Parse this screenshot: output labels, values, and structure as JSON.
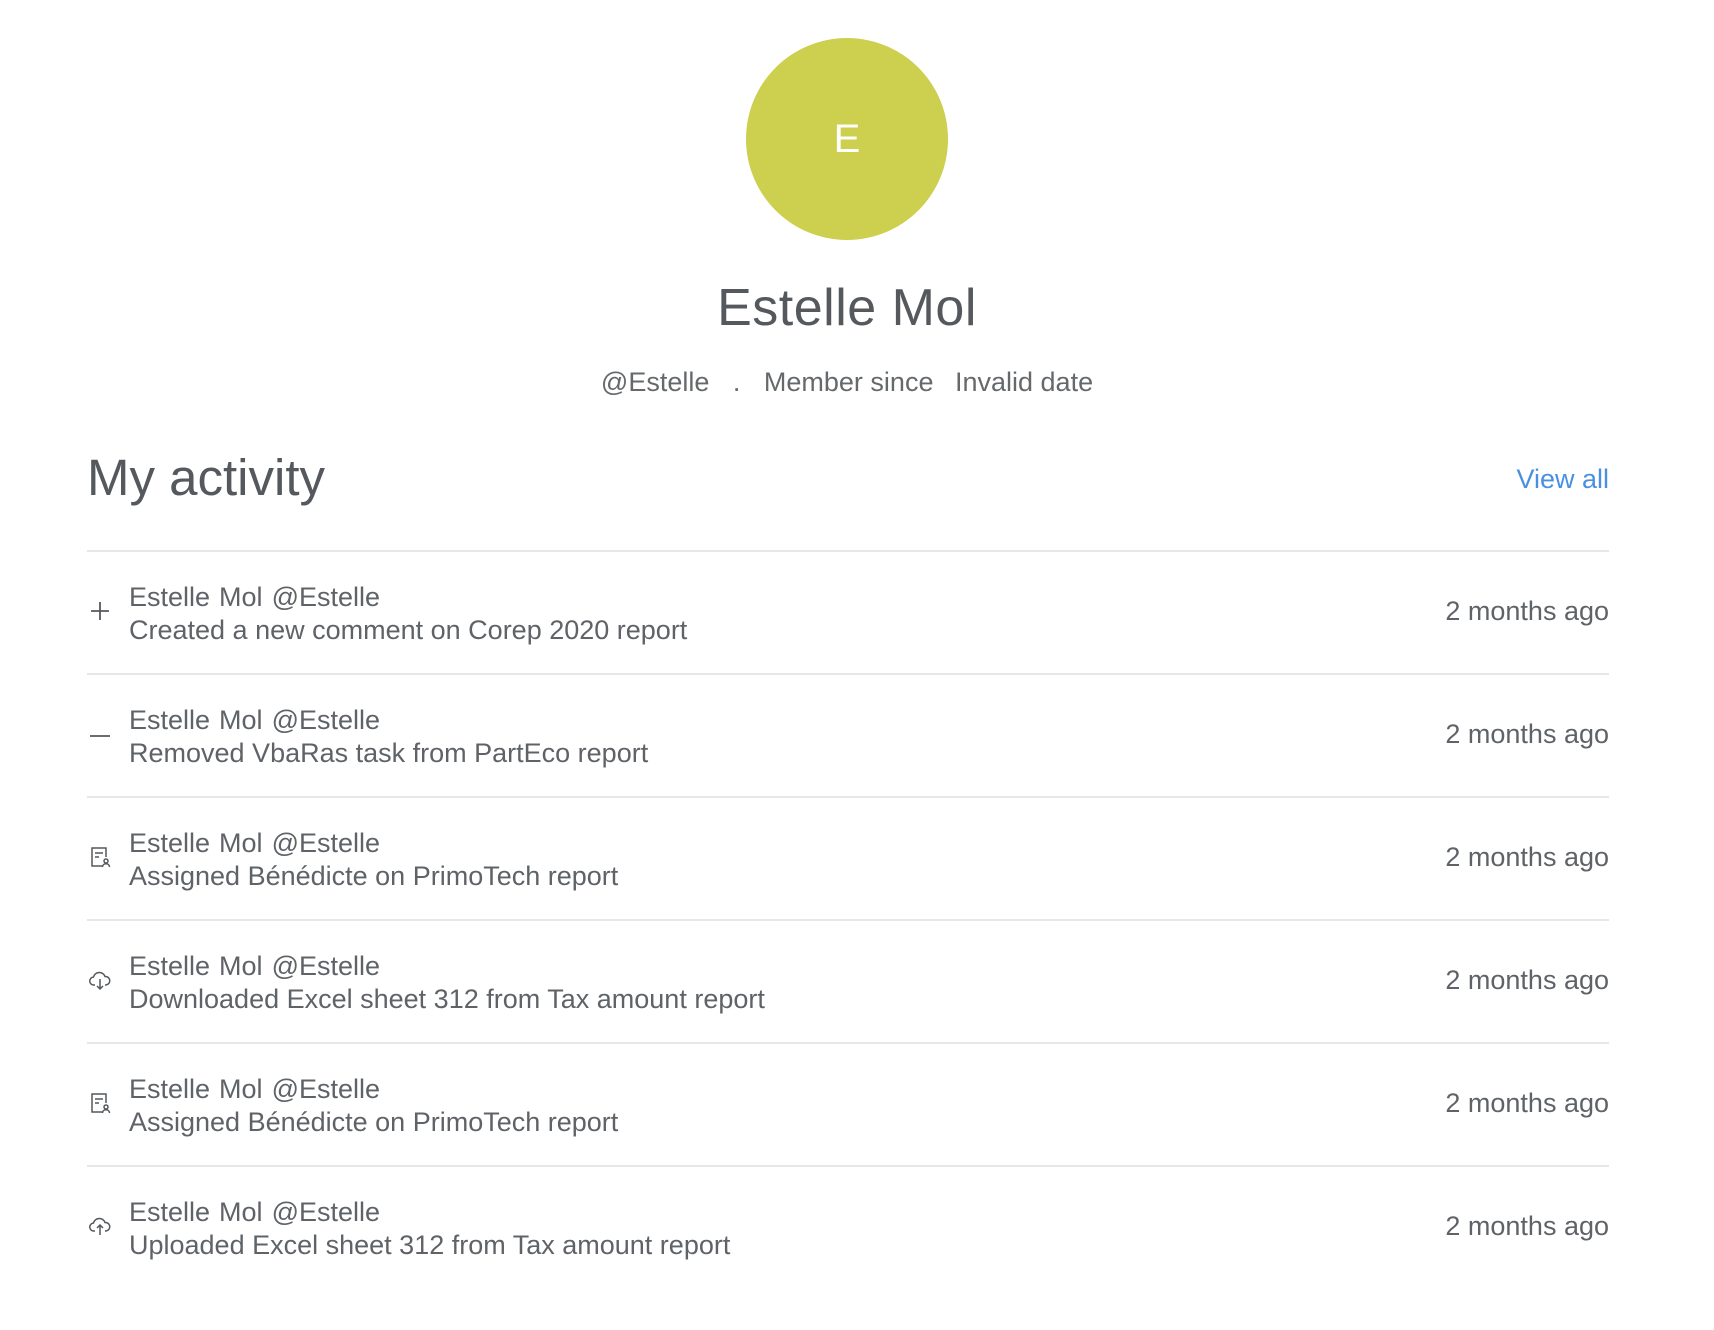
{
  "profile": {
    "avatar_initial": "E",
    "avatar_color": "#cdcf4e",
    "name": "Estelle Mol",
    "handle": "@Estelle",
    "separator": ".",
    "member_since_label": "Member since",
    "member_since_value": "Invalid date"
  },
  "activity": {
    "title": "My activity",
    "view_all_label": "View all",
    "link_color": "#4a90e2",
    "items": [
      {
        "icon": "plus-icon",
        "first_name": "Estelle",
        "last_name": "Mol",
        "handle": "@Estelle",
        "description": "Created a new comment on Corep 2020 report",
        "time": "2 months ago"
      },
      {
        "icon": "minus-icon",
        "first_name": "Estelle",
        "last_name": "Mol",
        "handle": "@Estelle",
        "description": "Removed VbaRas task from PartEco report",
        "time": "2 months ago"
      },
      {
        "icon": "assign-icon",
        "first_name": "Estelle",
        "last_name": "Mol",
        "handle": "@Estelle",
        "description": "Assigned Bénédicte on PrimoTech report",
        "time": "2 months ago"
      },
      {
        "icon": "cloud-download-icon",
        "first_name": "Estelle",
        "last_name": "Mol",
        "handle": "@Estelle",
        "description": "Downloaded Excel sheet 312 from Tax amount report",
        "time": "2 months ago"
      },
      {
        "icon": "assign-icon",
        "first_name": "Estelle",
        "last_name": "Mol",
        "handle": "@Estelle",
        "description": "Assigned Bénédicte on PrimoTech report",
        "time": "2 months ago"
      },
      {
        "icon": "cloud-upload-icon",
        "first_name": "Estelle",
        "last_name": "Mol",
        "handle": "@Estelle",
        "description": "Uploaded Excel sheet 312 from Tax amount report",
        "time": "2 months ago"
      }
    ]
  }
}
